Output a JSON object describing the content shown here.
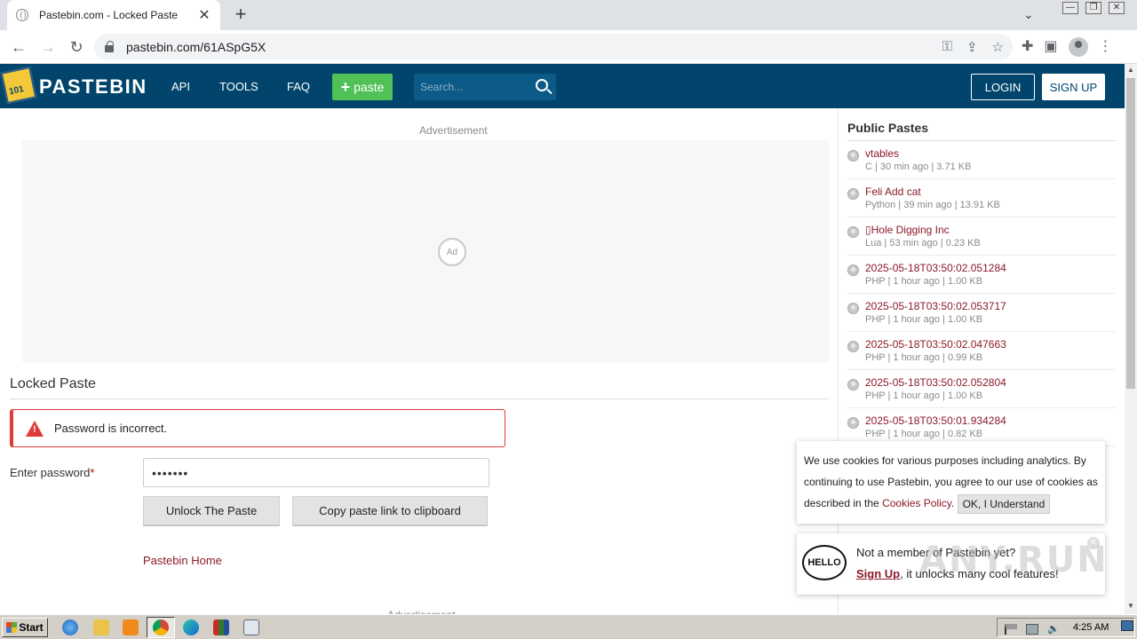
{
  "browser": {
    "tab_title": "Pastebin.com - Locked Paste",
    "tab_close": "✕",
    "new_tab": "+",
    "url": "pastebin.com/61ASpG5X",
    "window_buttons": [
      "—",
      "❐",
      "✕"
    ]
  },
  "header": {
    "logo_text": "PASTEBIN",
    "nav": [
      "API",
      "TOOLS",
      "FAQ"
    ],
    "paste_button": "paste",
    "search_placeholder": "Search...",
    "login": "LOGIN",
    "signup": "SIGN UP"
  },
  "main": {
    "ad_label": "Advertisement",
    "ad_badge": "Ad",
    "locked_title": "Locked Paste",
    "error_message": "Password is incorrect.",
    "password_label": "Enter password",
    "password_required": "*",
    "password_value": "•••••••",
    "unlock_button": "Unlock The Paste",
    "copy_button": "Copy paste link to clipboard",
    "home_link": "Pastebin Home",
    "ad_label_bottom": "Advertisement"
  },
  "sidebar": {
    "title": "Public Pastes",
    "pastes": [
      {
        "title": "vtables",
        "meta": "C | 30 min ago | 3.71 KB"
      },
      {
        "title": "Feli Add cat",
        "meta": "Python | 39 min ago | 13.91 KB"
      },
      {
        "title": "▯Hole Digging Inc",
        "meta": "Lua | 53 min ago | 0.23 KB"
      },
      {
        "title": "2025-05-18T03:50:02.051284",
        "meta": "PHP | 1 hour ago | 1.00 KB"
      },
      {
        "title": "2025-05-18T03:50:02.053717",
        "meta": "PHP | 1 hour ago | 1.00 KB"
      },
      {
        "title": "2025-05-18T03:50:02.047663",
        "meta": "PHP | 1 hour ago | 0.99 KB"
      },
      {
        "title": "2025-05-18T03:50:02.052804",
        "meta": "PHP | 1 hour ago | 1.00 KB"
      },
      {
        "title": "2025-05-18T03:50:01.934284",
        "meta": "PHP | 1 hour ago | 0.82 KB"
      }
    ]
  },
  "cookie": {
    "text_before": "We use cookies for various purposes including analytics. By continuing to use Pastebin, you agree to our use of cookies as described in the ",
    "policy_link": "Cookies Policy",
    "text_after": ".",
    "ok_button": "OK, I Understand"
  },
  "member_popup": {
    "hello_icon_text": "HELLO",
    "line1": "Not a member of Pastebin yet?",
    "signup_link": "Sign Up",
    "line2_rest": ", it unlocks many cool features!",
    "close": "✕"
  },
  "watermark": "ANY.RUN",
  "taskbar": {
    "start": "Start",
    "clock": "4:25 AM"
  },
  "colors": {
    "header_bg": "#02456c",
    "paste_green": "#50c156",
    "link_maroon": "#8b1a2a",
    "error_red": "#e03a3a"
  }
}
